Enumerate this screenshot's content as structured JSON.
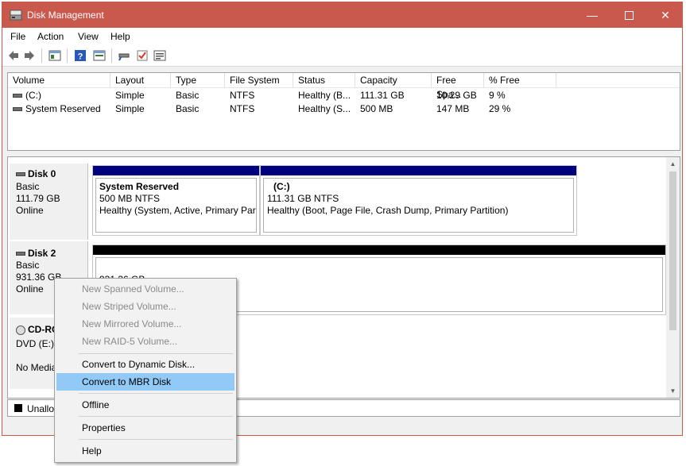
{
  "window": {
    "title": "Disk Management"
  },
  "menu": [
    "File",
    "Action",
    "View",
    "Help"
  ],
  "volume_list": {
    "columns": [
      "Volume",
      "Layout",
      "Type",
      "File System",
      "Status",
      "Capacity",
      "Free Spa...",
      "% Free"
    ],
    "rows": [
      [
        "(C:)",
        "Simple",
        "Basic",
        "NTFS",
        "Healthy (B...",
        "111.31 GB",
        "10.29 GB",
        "9 %"
      ],
      [
        "System Reserved",
        "Simple",
        "Basic",
        "NTFS",
        "Healthy (S...",
        "500 MB",
        "147 MB",
        "29 %"
      ]
    ]
  },
  "disks": [
    {
      "name": "Disk 0",
      "type": "Basic",
      "size": "111.79 GB",
      "status": "Online",
      "partitions": [
        {
          "name": "System Reserved",
          "size": "500 MB NTFS",
          "status": "Healthy (System, Active, Primary Part"
        },
        {
          "name": "(C:)",
          "size": "111.31 GB NTFS",
          "status": "Healthy (Boot, Page File, Crash Dump, Primary Partition)"
        }
      ]
    },
    {
      "name": "Disk 2",
      "type": "Basic",
      "size": "931.36 GB",
      "status": "Online",
      "partitions": [
        {
          "size": "931.36 GB"
        }
      ]
    },
    {
      "name": "CD-RO",
      "type": "DVD (E:)",
      "status": "No Media"
    }
  ],
  "legend": {
    "unallocated": "Unalloc"
  },
  "context_menu": {
    "items": [
      {
        "label": "New Spanned Volume...",
        "enabled": false
      },
      {
        "label": "New Striped Volume...",
        "enabled": false
      },
      {
        "label": "New Mirrored Volume...",
        "enabled": false
      },
      {
        "label": "New RAID-5 Volume...",
        "enabled": false
      },
      {
        "label": "Convert to Dynamic Disk...",
        "enabled": true
      },
      {
        "label": "Convert to MBR Disk",
        "enabled": true,
        "highlighted": true
      },
      {
        "label": "Offline",
        "enabled": true
      },
      {
        "label": "Properties",
        "enabled": true
      },
      {
        "label": "Help",
        "enabled": true
      }
    ]
  },
  "colors": {
    "titlebar": "#c8594c",
    "primary_partition": "#00007f",
    "unallocated": "#000000",
    "highlight": "#91c9f7"
  },
  "icons": [
    "back-arrow-icon",
    "forward-arrow-icon",
    "properties-icon",
    "help-icon",
    "show-hide-icon",
    "connect-icon",
    "check-icon",
    "settings-list-icon"
  ]
}
